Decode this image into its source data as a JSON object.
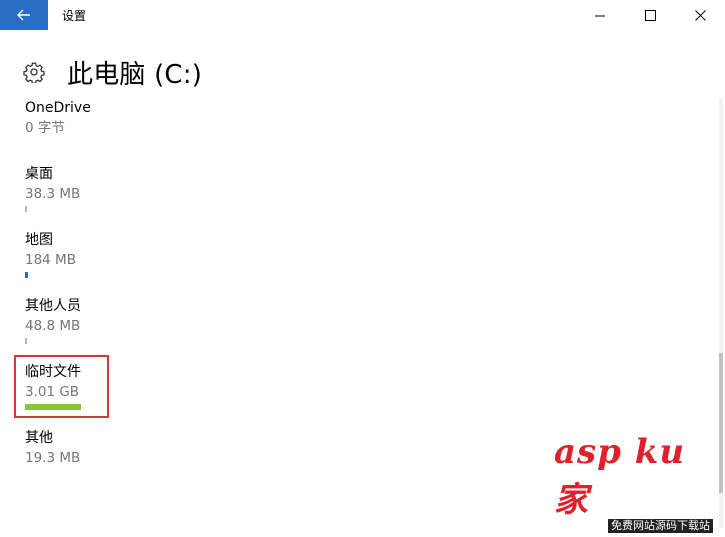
{
  "window": {
    "title": "设置"
  },
  "page": {
    "title": "此电脑 (C:)"
  },
  "items": [
    {
      "name": "OneDrive",
      "size": "0 字节",
      "fill": 0,
      "color": "#2b6cc4"
    },
    {
      "name": "桌面",
      "size": "38.3 MB",
      "fill": 0.01,
      "color": "#2b6cc4"
    },
    {
      "name": "地图",
      "size": "184 MB",
      "fill": 0.02,
      "color": "#2b6cc4"
    },
    {
      "name": "其他人员",
      "size": "48.8 MB",
      "fill": 0.01,
      "color": "#2b6cc4"
    },
    {
      "name": "临时文件",
      "size": "3.01 GB",
      "fill": 0.12,
      "color": "#8cc43f"
    },
    {
      "name": "其他",
      "size": "19.3 MB",
      "fill": 0,
      "color": "#2b6cc4"
    }
  ],
  "icons": {
    "back": "arrow-left-icon",
    "settings": "gear-icon",
    "minimize": "minimize-icon",
    "maximize": "maximize-icon",
    "close": "close-icon"
  },
  "colors": {
    "accent": "#2b6cc4",
    "temp_bar": "#8cc43f",
    "highlight": "#d9363e"
  },
  "watermark": {
    "brand": "asp ku 家",
    "tagline": "免费网站源码下载站"
  }
}
